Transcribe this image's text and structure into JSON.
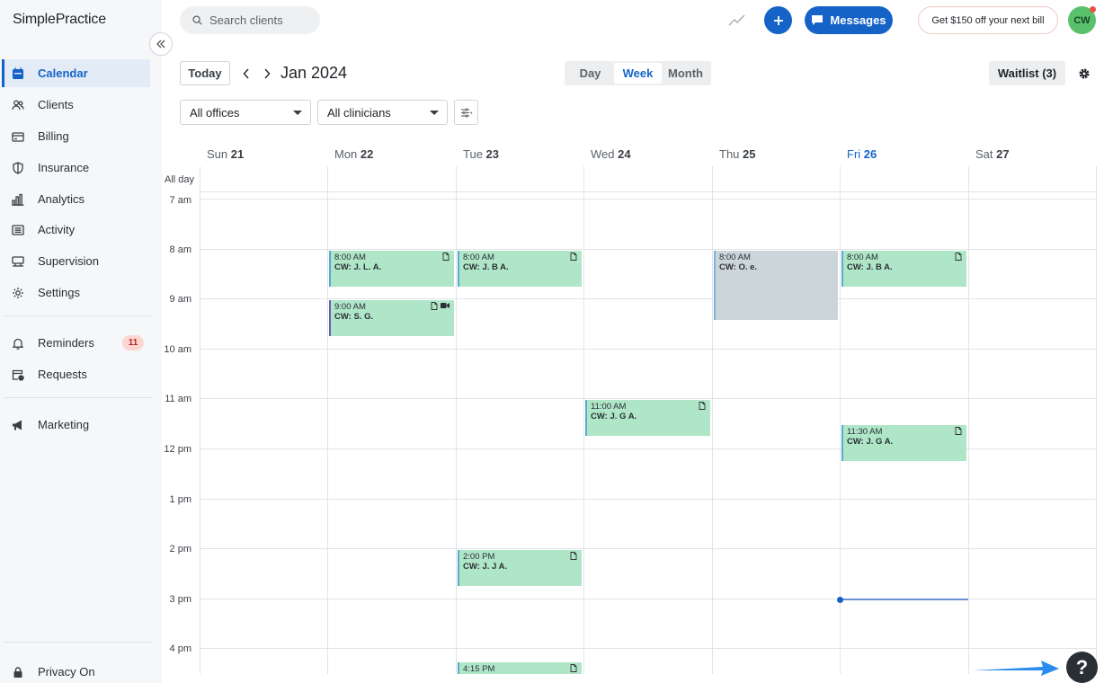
{
  "sidebar": {
    "logo": "SimplePractice",
    "items": [
      {
        "label": "Calendar"
      },
      {
        "label": "Clients"
      },
      {
        "label": "Billing"
      },
      {
        "label": "Insurance"
      },
      {
        "label": "Analytics"
      },
      {
        "label": "Activity"
      },
      {
        "label": "Supervision"
      },
      {
        "label": "Settings"
      },
      {
        "label": "Reminders",
        "badge": "11"
      },
      {
        "label": "Requests"
      },
      {
        "label": "Marketing"
      },
      {
        "label": "Privacy On"
      }
    ],
    "collapse_icon": "double-chevron-left-icon"
  },
  "topbar": {
    "search_placeholder": "Search clients",
    "messages_label": "Messages",
    "promo_label": "Get $150 off your next bill",
    "avatar_initials": "CW"
  },
  "toolbar": {
    "today_label": "Today",
    "date_title": "Jan 2024",
    "views": [
      "Day",
      "Week",
      "Month"
    ],
    "selected_view": "Week",
    "waitlist_label": "Waitlist (3)",
    "office_select": "All offices",
    "clinician_select": "All clinicians"
  },
  "calendar": {
    "allday_label": "All day",
    "days": [
      {
        "name": "Sun",
        "num": "21"
      },
      {
        "name": "Mon",
        "num": "22"
      },
      {
        "name": "Tue",
        "num": "23"
      },
      {
        "name": "Wed",
        "num": "24"
      },
      {
        "name": "Thu",
        "num": "25"
      },
      {
        "name": "Fri",
        "num": "26",
        "today": true
      },
      {
        "name": "Sat",
        "num": "27"
      }
    ],
    "times": [
      "7 am",
      "8 am",
      "9 am",
      "10 am",
      "11 am",
      "12 pm",
      "1 pm",
      "2 pm",
      "3 pm",
      "4 pm"
    ],
    "events": [
      {
        "day": "Mon",
        "time": "8:00 AM",
        "name": "CW: J. L. A."
      },
      {
        "day": "Mon",
        "time": "9:00 AM",
        "name": "CW: S. G.",
        "video": true
      },
      {
        "day": "Tue",
        "time": "8:00 AM",
        "name": "CW: J. B A."
      },
      {
        "day": "Tue",
        "time": "2:00 PM",
        "name": "CW: J. J A."
      },
      {
        "day": "Tue",
        "time": "4:15 PM",
        "name": ""
      },
      {
        "day": "Wed",
        "time": "11:00 AM",
        "name": "CW: J. G A."
      },
      {
        "day": "Thu",
        "time": "8:00 AM",
        "name": "CW: O. e."
      },
      {
        "day": "Fri",
        "time": "8:00 AM",
        "name": "CW: J. B A."
      },
      {
        "day": "Fri",
        "time": "11:30 AM",
        "name": "CW: J. G A."
      }
    ]
  },
  "help_label": "?",
  "colors": {
    "accent": "#1663c7",
    "event_green": "#b0e6c8",
    "event_gray": "#ccd5da"
  }
}
